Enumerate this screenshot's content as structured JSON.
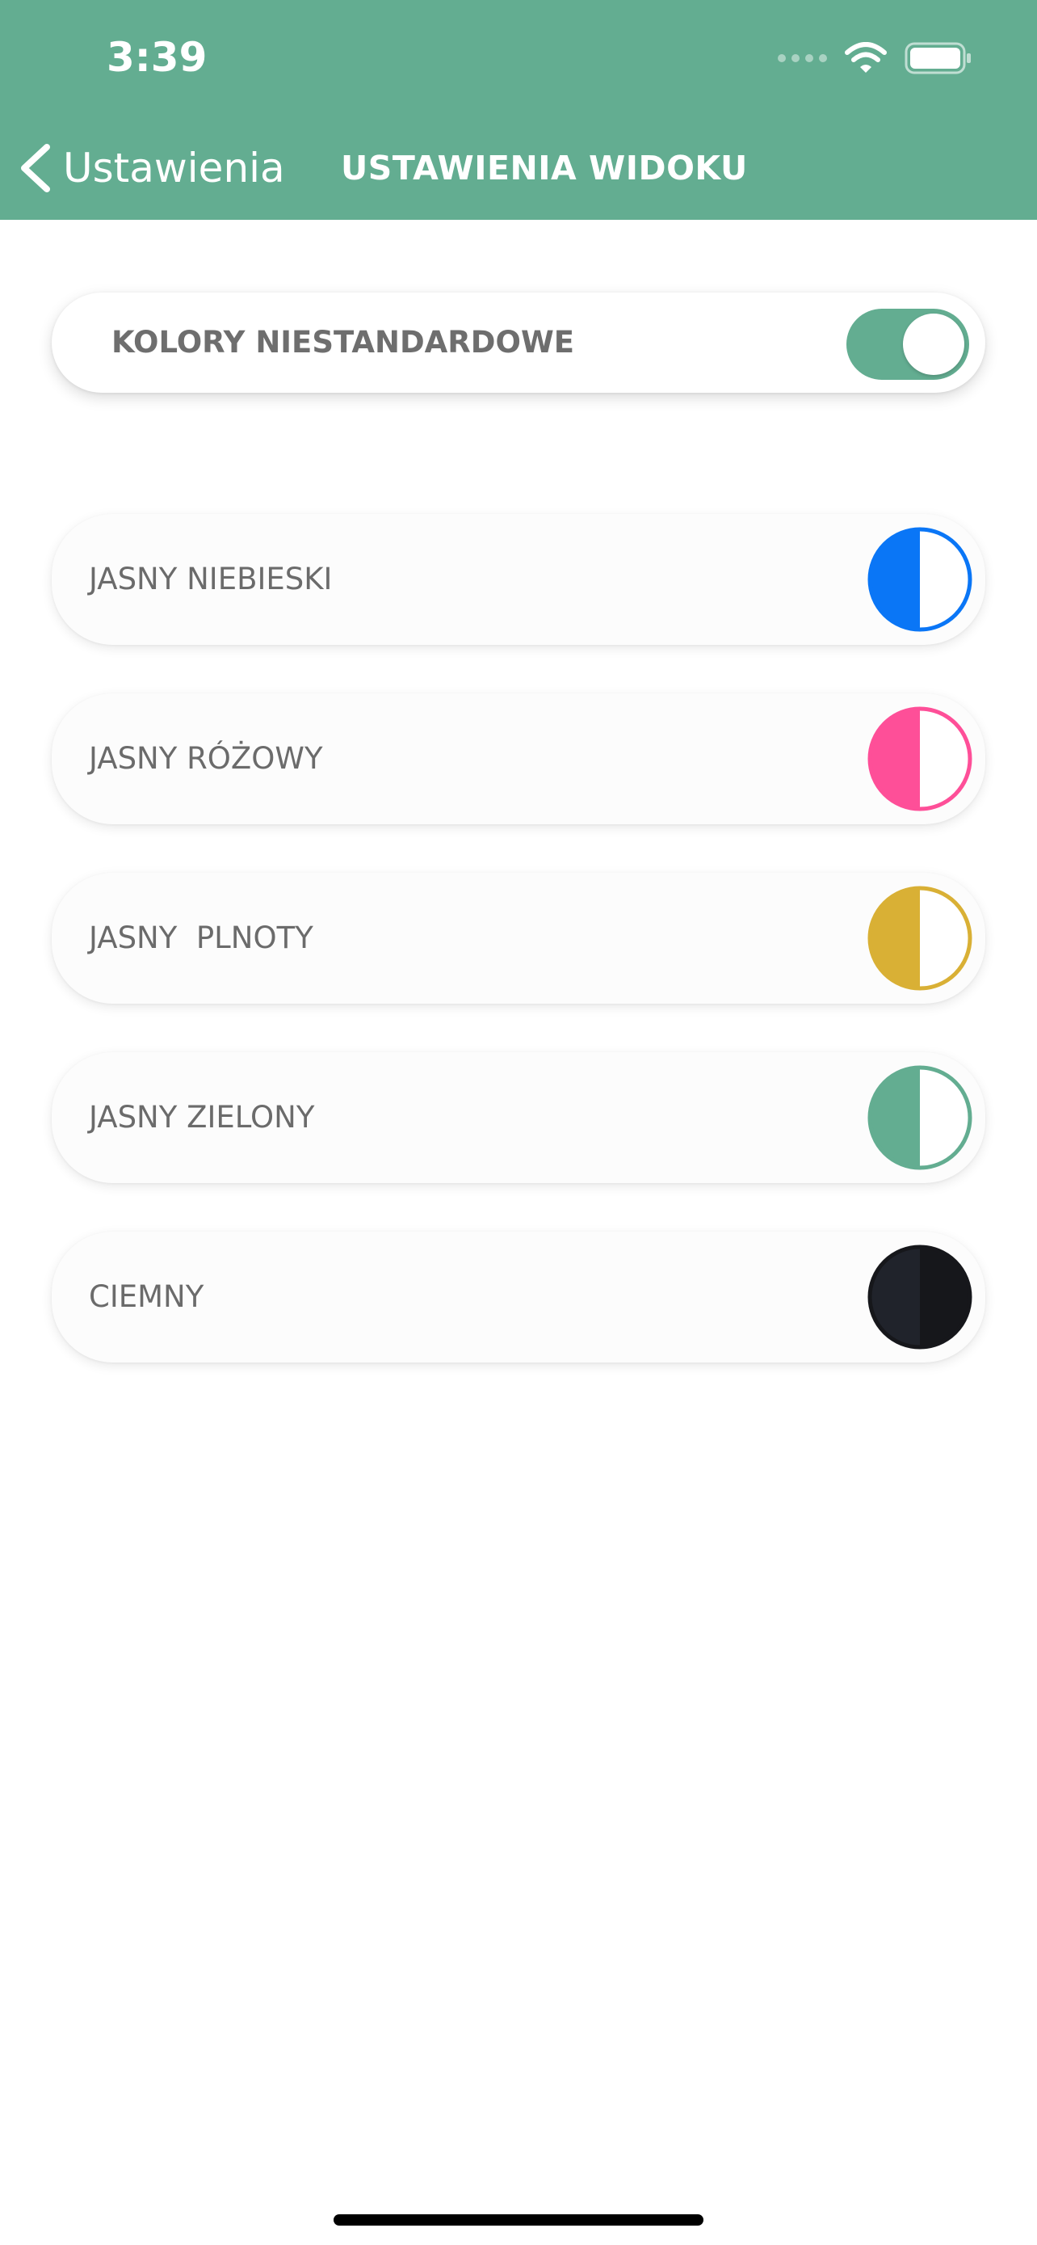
{
  "status_bar": {
    "time": "3:39"
  },
  "nav": {
    "back_label": "Ustawienia",
    "title": "USTAWIENIA WIDOKU"
  },
  "custom_colors": {
    "label": "KOLORY NIESTANDARDOWE",
    "enabled": true
  },
  "themes": [
    {
      "label": "JASNY NIEBIESKI",
      "fill": "#0a76f6",
      "outline": "#0a76f6",
      "right_fill": "#ffffff"
    },
    {
      "label": "JASNY RÓŻOWY",
      "fill": "#fe4f98",
      "outline": "#fe4f98",
      "right_fill": "#ffffff"
    },
    {
      "label": "JASNY  PLNOTY",
      "fill": "#d9b035",
      "outline": "#d9b035",
      "right_fill": "#ffffff"
    },
    {
      "label": "JASNY ZIELONY",
      "fill": "#63ad91",
      "outline": "#63ad91",
      "right_fill": "#ffffff"
    },
    {
      "label": "CIEMNY",
      "fill": "#20232b",
      "outline": "#16171b",
      "right_fill": "#16171b"
    }
  ],
  "colors": {
    "header": "#63ad91",
    "text_gray": "#6b6b6b"
  },
  "icons": {
    "back": "chevron-left-icon",
    "wifi": "wifi-icon",
    "battery": "battery-icon",
    "signal": "cellular-signal-icon"
  }
}
